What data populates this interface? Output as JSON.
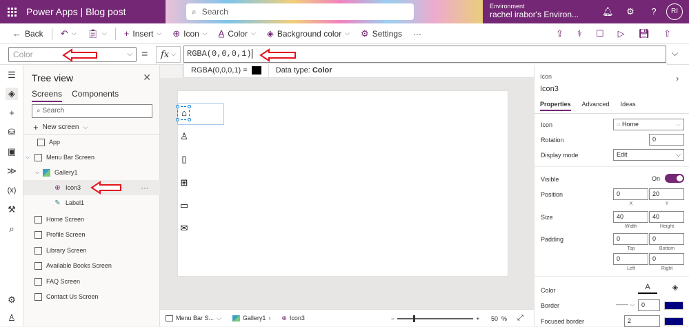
{
  "titlebar": {
    "app_title": "Power Apps  |  Blog post",
    "search_placeholder": "Search",
    "environment_label": "Environment",
    "environment_name": "rachel irabor's Environ...",
    "avatar_initials": "RI"
  },
  "commandbar": {
    "back": "Back",
    "insert": "Insert",
    "icon": "Icon",
    "color": "Color",
    "background_color": "Background color",
    "settings": "Settings",
    "more": "···"
  },
  "formulabar": {
    "property": "Color",
    "equals": "=",
    "fx": "fx",
    "formula": "RGBA(0,0,0,1)",
    "tooltip_value": "RGBA(0,0,0,1)  =",
    "tooltip_datatype_label": "Data type:",
    "tooltip_datatype_value": "Color"
  },
  "treeview": {
    "title": "Tree view",
    "tabs": [
      "Screens",
      "Components"
    ],
    "search_placeholder": "Search",
    "new_screen": "New screen",
    "items": [
      {
        "label": "App"
      },
      {
        "label": "Menu Bar Screen"
      },
      {
        "label": "Gallery1"
      },
      {
        "label": "Icon3"
      },
      {
        "label": "Label1"
      },
      {
        "label": "Home Screen"
      },
      {
        "label": "Profile Screen"
      },
      {
        "label": "Library Screen"
      },
      {
        "label": "Available Books Screen"
      },
      {
        "label": "FAQ Screen"
      },
      {
        "label": "Contact Us Screen"
      }
    ]
  },
  "statusbar": {
    "crumb1": "Menu Bar S...",
    "crumb2": "Gallery1",
    "crumb3": "Icon3",
    "zoom_minus": "−",
    "zoom_plus": "+",
    "zoom_pct": "50",
    "pct_sign": "%",
    "zoom_level": 50
  },
  "properties": {
    "type_label": "Icon",
    "name": "Icon3",
    "tabs": [
      "Properties",
      "Advanced",
      "Ideas"
    ],
    "icon_label": "Icon",
    "icon_value": "Home",
    "rotation_label": "Rotation",
    "rotation_value": "0",
    "display_mode_label": "Display mode",
    "display_mode_value": "Edit",
    "visible_label": "Visible",
    "visible_value": "On",
    "position_label": "Position",
    "position_x": "0",
    "position_y": "20",
    "x_caption": "X",
    "y_caption": "Y",
    "size_label": "Size",
    "width_value": "40",
    "height_value": "40",
    "width_caption": "Width",
    "height_caption": "Height",
    "padding_label": "Padding",
    "pad_top": "0",
    "pad_bottom": "0",
    "pad_left": "0",
    "pad_right": "0",
    "top_caption": "Top",
    "bottom_caption": "Bottom",
    "left_caption": "Left",
    "right_caption": "Right",
    "color_label": "Color",
    "border_label": "Border",
    "border_value": "0",
    "focused_border_label": "Focused border",
    "focused_border_value": "2",
    "border_color": "#000080"
  },
  "colors": {
    "brand": "#742774",
    "annotation": "#e3141e"
  }
}
